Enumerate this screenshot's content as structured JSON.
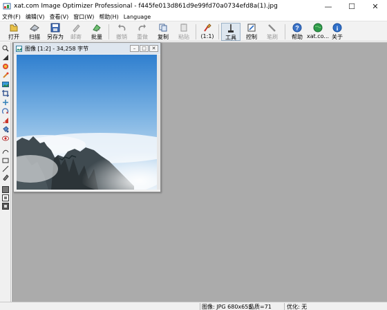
{
  "window": {
    "title": "xat.com  Image Optimizer Professional - f445fe013d861d9e99fd70a0734efd8a(1).jpg",
    "controls": {
      "minimize": "—",
      "maximize": "☐",
      "close": "✕"
    }
  },
  "menu": [
    "文件(F)",
    "编辑(V)",
    "查看(V)",
    "窗口(W)",
    "帮助(H)",
    "Language"
  ],
  "toolbar": {
    "open": "打开",
    "scan": "扫描",
    "save_as": "另存为",
    "email": "邮寄",
    "batch": "批量",
    "undo": "撤销",
    "redo": "重做",
    "copy": "复制",
    "paste": "粘贴",
    "zoom_1_1": "(1:1)",
    "tools": "工具",
    "control": "控制",
    "brush": "笔刷",
    "help": "帮助",
    "xat": "xat.co...",
    "about": "关于"
  },
  "child_window": {
    "title": "图像  [1:2] - 34,258 字节",
    "controls": {
      "minimize": "–",
      "restore": "□",
      "close": "✕"
    }
  },
  "status": {
    "image_info": "图像: JPG 680x655",
    "quality": "品质=71",
    "optimize": "优化: 无"
  },
  "colors": {
    "workspace": "#ababab",
    "toolbar": "#f2f2f2",
    "child_titlebar": "#dee6ef",
    "sky_top": "#2f7fcf",
    "sky_bottom": "#e8f1f8"
  }
}
